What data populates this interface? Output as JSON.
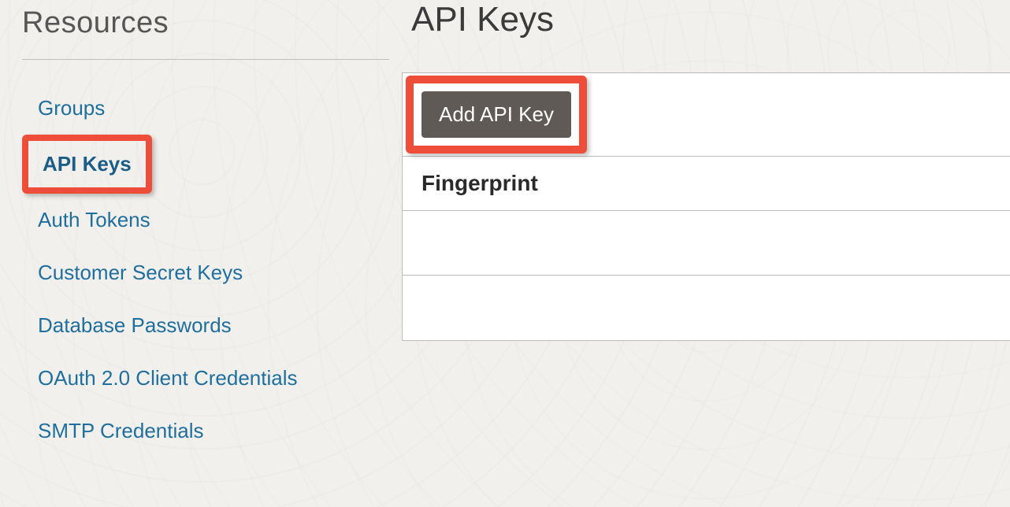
{
  "sidebar": {
    "title": "Resources",
    "items": [
      {
        "label": "Groups",
        "active": false,
        "highlighted": false
      },
      {
        "label": "API Keys",
        "active": true,
        "highlighted": true
      },
      {
        "label": "Auth Tokens",
        "active": false,
        "highlighted": false
      },
      {
        "label": "Customer Secret Keys",
        "active": false,
        "highlighted": false
      },
      {
        "label": "Database Passwords",
        "active": false,
        "highlighted": false
      },
      {
        "label": "OAuth 2.0 Client Credentials",
        "active": false,
        "highlighted": false
      },
      {
        "label": "SMTP Credentials",
        "active": false,
        "highlighted": false
      }
    ]
  },
  "main": {
    "title": "API Keys",
    "add_button_label": "Add API Key",
    "table": {
      "columns": [
        "Fingerprint"
      ],
      "rows": []
    }
  },
  "highlight_color": "#ee4d3a"
}
